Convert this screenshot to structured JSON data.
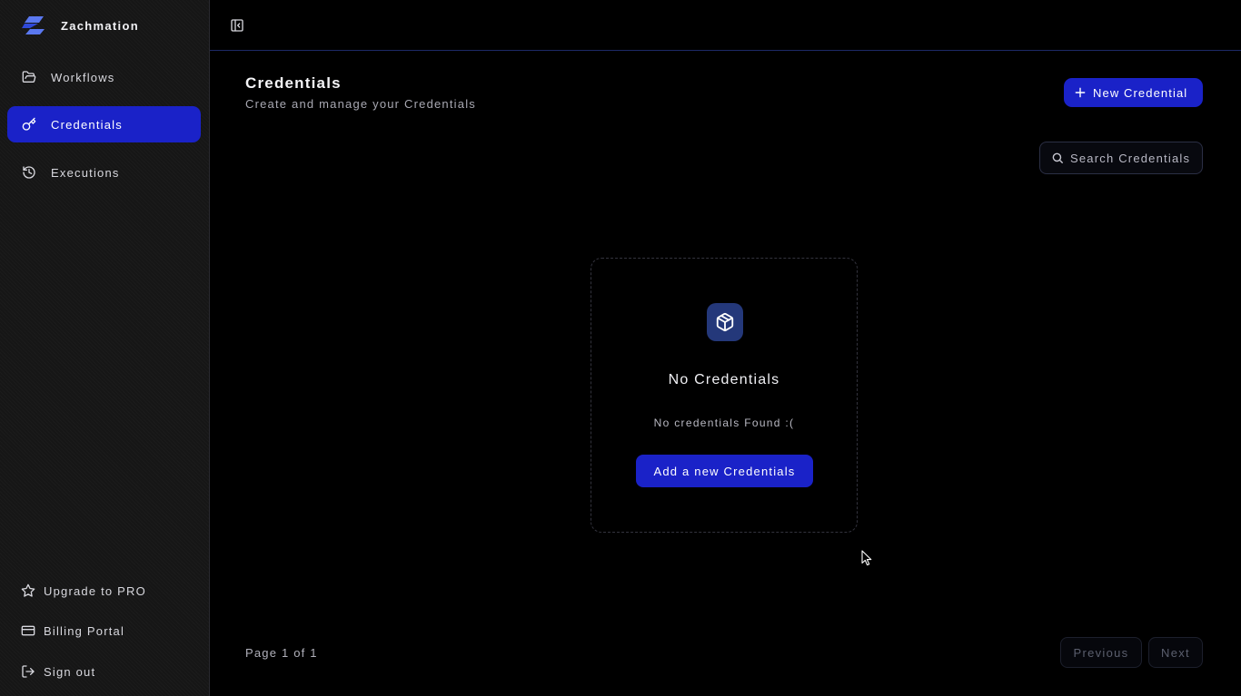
{
  "app": {
    "name": "Zachmation",
    "accent_color": "#1a22c8"
  },
  "sidebar": {
    "items": [
      {
        "label": "Workflows",
        "icon": "folder-open-icon",
        "active": false
      },
      {
        "label": "Credentials",
        "icon": "key-icon",
        "active": true
      },
      {
        "label": "Executions",
        "icon": "history-icon",
        "active": false
      }
    ],
    "footer": [
      {
        "label": "Upgrade to PRO",
        "icon": "star-icon"
      },
      {
        "label": "Billing Portal",
        "icon": "credit-card-icon"
      },
      {
        "label": "Sign out",
        "icon": "log-out-icon"
      }
    ]
  },
  "header": {
    "toggle_icon": "sidebar-toggle-icon"
  },
  "main": {
    "title": "Credentials",
    "subtitle": "Create and manage your Credentials",
    "new_button_label": "New Credential",
    "search_placeholder": "Search Credentials",
    "search_value": ""
  },
  "empty_state": {
    "icon": "package-icon",
    "title": "No Credentials",
    "description": "No credentials Found :(",
    "button_label": "Add a new Credentials"
  },
  "pagination": {
    "info": "Page 1 of 1",
    "previous_label": "Previous",
    "next_label": "Next"
  }
}
